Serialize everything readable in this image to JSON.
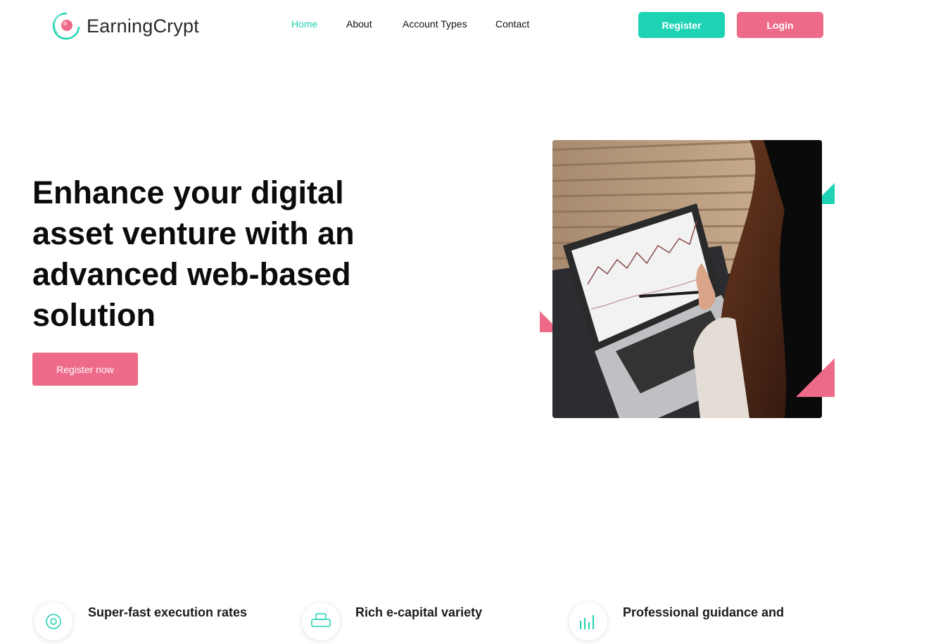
{
  "brand": {
    "name": "EarningCrypt"
  },
  "nav": {
    "items": [
      {
        "label": "Home",
        "active": true
      },
      {
        "label": "About"
      },
      {
        "label": "Account Types"
      },
      {
        "label": "Contact"
      }
    ]
  },
  "header_buttons": {
    "register": "Register",
    "login": "Login"
  },
  "hero": {
    "title": "Enhance your digital asset venture with an advanced web-based solution",
    "cta": "Register now",
    "image": "person-using-laptop-with-trading-chart"
  },
  "features": [
    {
      "title": "Super-fast execution rates",
      "icon": "gear-icon"
    },
    {
      "title": "Rich e-capital variety",
      "icon": "coins-icon"
    },
    {
      "title": "Professional guidance and",
      "icon": "bar-chart-icon"
    }
  ],
  "colors": {
    "accent": "#1ed3b3",
    "brand_pink": "#ee6a89",
    "text": "#111111"
  }
}
